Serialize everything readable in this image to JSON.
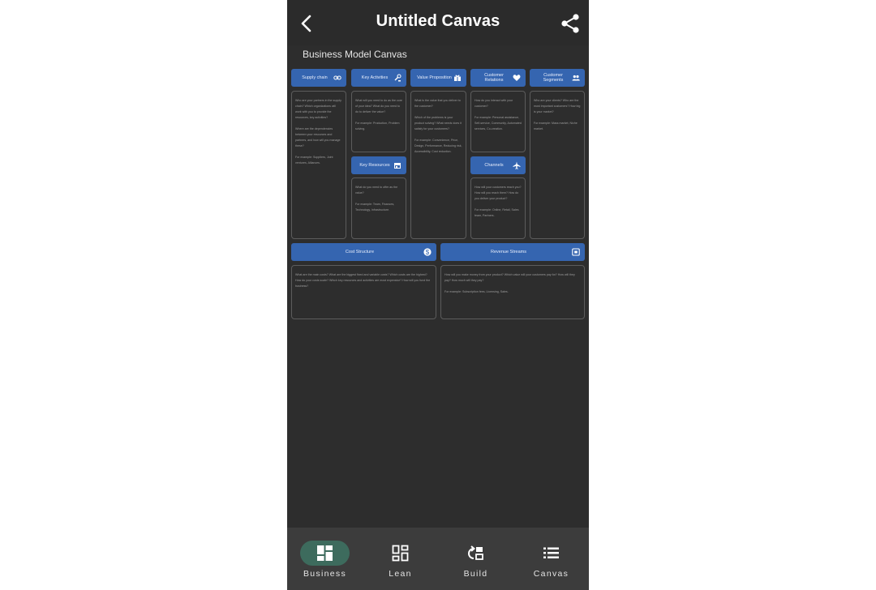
{
  "app": {
    "title": "Untitled Canvas",
    "back_icon": "back-arrow-icon",
    "share_icon": "share-icon"
  },
  "canvas": {
    "title": "Business Model Canvas",
    "accent_color": "#3565b0",
    "blocks": {
      "supply_chain": {
        "label": "Supply chain",
        "icon": "link-icon",
        "prompts": [
          "Who are your partners in the supply chain? Which organizations will work with you to provide the resources, key activities?",
          "Where are the dependencies between your resources and partners, and how will you manage these?",
          "For example: Suppliers, Joint ventures, Alliances."
        ]
      },
      "key_activities": {
        "label": "Key Activities",
        "icon": "tools-icon",
        "prompts": [
          "What will you need to do as the core of your idea? What do you need to do to deliver the value?",
          "For example: Production, Problem solving."
        ]
      },
      "key_resources": {
        "label": "Key Resources",
        "icon": "store-icon",
        "prompts": [
          "What do you need to offer as the value?",
          "For example: Team, Finances, Technology, Infrastructure."
        ]
      },
      "value_proposition": {
        "label": "Value Proposition",
        "icon": "gift-icon",
        "prompts": [
          "What is the value that you deliver to the customer?",
          "Which of the problems is your product solving? What needs does it satisfy for your customers?",
          "For example: Convenience, Price, Design, Performance, Reducing risk, Accessibility, Cost reduction."
        ]
      },
      "customer_relations": {
        "label": "Customer Relations",
        "icon": "heart-icon",
        "prompts": [
          "How do you interact with your customer?",
          "For example: Personal assistance, Self-service, Community, Automated services, Co-creation."
        ]
      },
      "channels": {
        "label": "Channels",
        "icon": "airplane-icon",
        "prompts": [
          "How will your customers reach you? How will you reach them? How do you deliver your product?",
          "For example: Online, Retail, Sales team, Partners."
        ]
      },
      "customer_segments": {
        "label": "Customer Segments",
        "icon": "people-icon",
        "prompts": [
          "Who are your clients? Who are the most important customers? How big is your market?",
          "For example: Mass market, Niche market."
        ]
      },
      "cost_structure": {
        "label": "Cost Structure",
        "icon": "dollar-icon",
        "prompts": [
          "What are the main costs? What are the biggest fixed and variable costs? Which costs are the highest? How do your costs scale? Which key resources and activities are most expensive? How will you fund the business?"
        ]
      },
      "revenue_streams": {
        "label": "Revenue Streams",
        "icon": "wallet-icon",
        "prompts": [
          "How will you make money from your product? Which value will your customers pay for? How will they pay? How much will they pay?",
          "For example: Subscription fees, Licensing, Sales."
        ]
      }
    }
  },
  "nav": {
    "active": "business",
    "active_color": "#3d6b5d",
    "items": [
      {
        "label": "Business",
        "icon": "dashboard-icon"
      },
      {
        "label": "Lean",
        "icon": "grid-icon"
      },
      {
        "label": "Build",
        "icon": "build-icon"
      },
      {
        "label": "Canvas",
        "icon": "list-icon"
      }
    ]
  }
}
